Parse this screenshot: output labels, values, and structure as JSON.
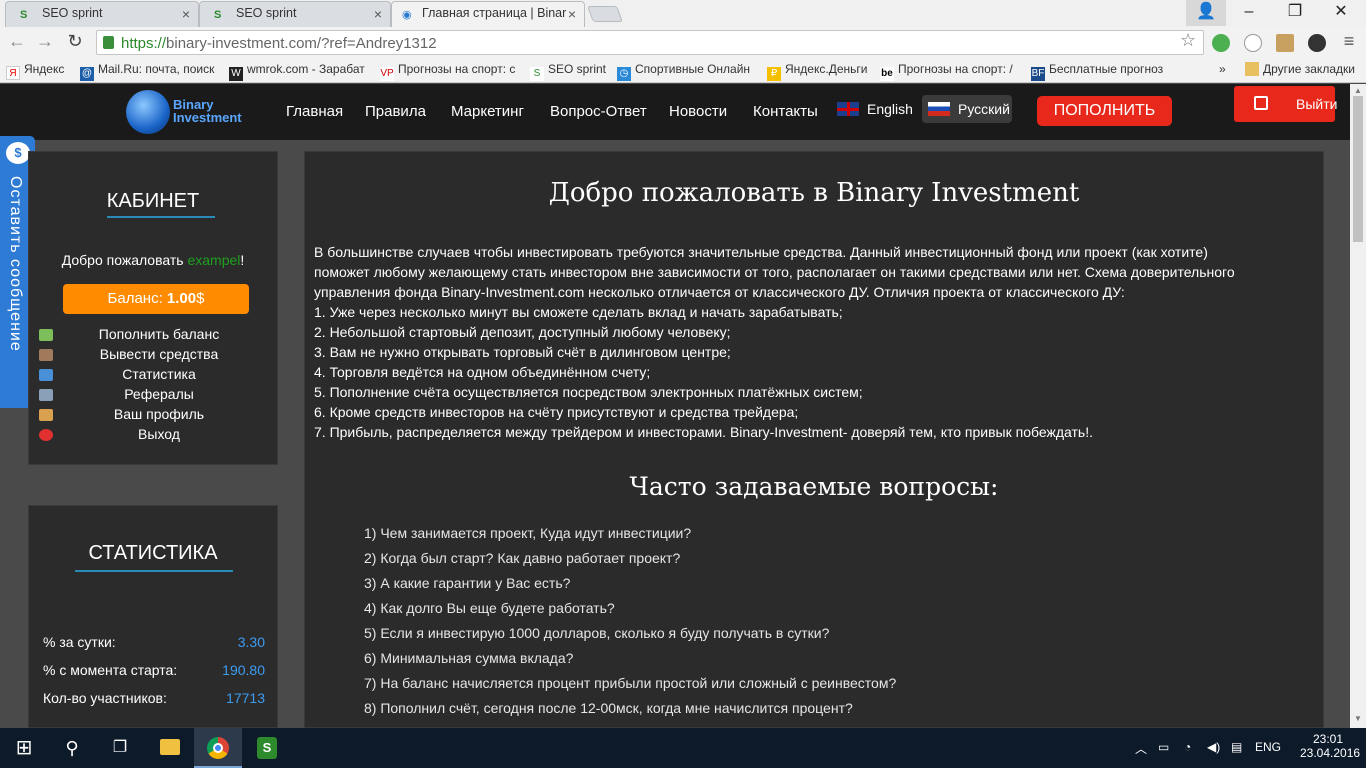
{
  "browser": {
    "tabs": [
      {
        "title": "SEO sprint",
        "icon": "seo-sprint-favicon"
      },
      {
        "title": "SEO sprint",
        "icon": "seo-sprint-favicon"
      },
      {
        "title": "Главная страница | Binar",
        "icon": "globe-favicon"
      }
    ],
    "url_prefix": "https://",
    "url_rest": "binary-investment.com/?ref=Andrey1312",
    "bookmarks": [
      "Яндекс",
      "Mail.Ru: почта, поиск",
      "wmrok.com - Зарабат",
      "Прогнозы на спорт: с",
      "SEO sprint",
      "Спортивные Онлайн",
      "Яндекс.Деньги",
      "Прогнозы на спорт: /",
      "Бесплатные прогноз",
      "»",
      "Другие закладки"
    ]
  },
  "site": {
    "logo_line1": "Binary",
    "logo_line2": "Investment",
    "nav": [
      "Главная",
      "Правила",
      "Маркетинг",
      "Вопрос-Ответ",
      "Новости",
      "Контакты"
    ],
    "lang_en": "English",
    "lang_ru": "Русский",
    "topup_button": "ПОПОЛНИТЬ",
    "exit_button": "Выйти",
    "feedback_tab": "Оставить сообщение"
  },
  "cabinet": {
    "title": "КАБИНЕТ",
    "welcome_prefix": "Добро пожаловать ",
    "username": "exampel",
    "welcome_suffix": "!",
    "balance_label": "Баланс: ",
    "balance_value": "1.00",
    "balance_currency": "$",
    "menu": [
      {
        "label": "Пополнить баланс",
        "icon": "wallet-icon",
        "color": "#7cbf5a"
      },
      {
        "label": "Вывести средства",
        "icon": "cash-icon",
        "color": "#a07a5a"
      },
      {
        "label": "Статистика",
        "icon": "chart-icon",
        "color": "#4a90d9"
      },
      {
        "label": "Рефералы",
        "icon": "users-icon",
        "color": "#8aa0b8"
      },
      {
        "label": "Ваш профиль",
        "icon": "user-icon",
        "color": "#d9a050"
      },
      {
        "label": "Выход",
        "icon": "power-icon",
        "color": "#e03030"
      }
    ]
  },
  "stats": {
    "title": "СТАТИСТИКА",
    "rows": [
      {
        "label": "% за сутки:",
        "value": "3.30"
      },
      {
        "label": "% с момента старта:",
        "value": "190.80"
      },
      {
        "label": "Кол-во участников:",
        "value": "17713"
      }
    ]
  },
  "main": {
    "heading": "Добро пожаловать в Binary Investment",
    "intro": [
      "В большинстве случаев чтобы инвестировать требуются значительные средства. Данный инвестиционный фонд или проект (как хотите)",
      "поможет любому желающему стать инвестором вне зависимости от того, располагает он такими средствами или нет. Схема доверительного",
      "управления фонда Binary-Investment.com несколько отличается от классического ДУ. Отличия проекта от классического ДУ:",
      "1. Уже через несколько минут вы сможете сделать вклад и начать зарабатывать;",
      "2. Небольшой стартовый депозит, доступный любому человеку;",
      "3. Вам не нужно открывать торговый счёт в дилинговом центре;",
      "4. Торговля ведётся на одном объединённом счету;",
      "5. Пополнение счёта осуществляется посредством электронных платёжных систем;",
      "6. Кроме средств инвесторов на счёту присутствуют и средства трейдера;",
      "7. Прибыль, распределяется между трейдером и инвесторами. Binary-Investment- доверяй тем, кто привык побеждать!."
    ],
    "faq_heading": "Часто задаваемые вопросы:",
    "faq": [
      "1) Чем занимается проект, Куда идут инвестиции?",
      "2) Когда был старт? Как давно работает проект?",
      "3) А какие гарантии у Вас есть?",
      "4) Как долго Вы еще будете работать?",
      "5) Если я инвестирую 1000 долларов, сколько я буду получать в сутки?",
      "6) Минимальная сумма вклада?",
      "7) На баланс начисляется процент прибыли простой или сложный с реинвестом?",
      "8) Пополнил счёт, сегодня после 12-00мск, когда мне начислится процент?"
    ]
  },
  "taskbar": {
    "lang": "ENG",
    "time": "23:01",
    "date": "23.04.2016"
  }
}
